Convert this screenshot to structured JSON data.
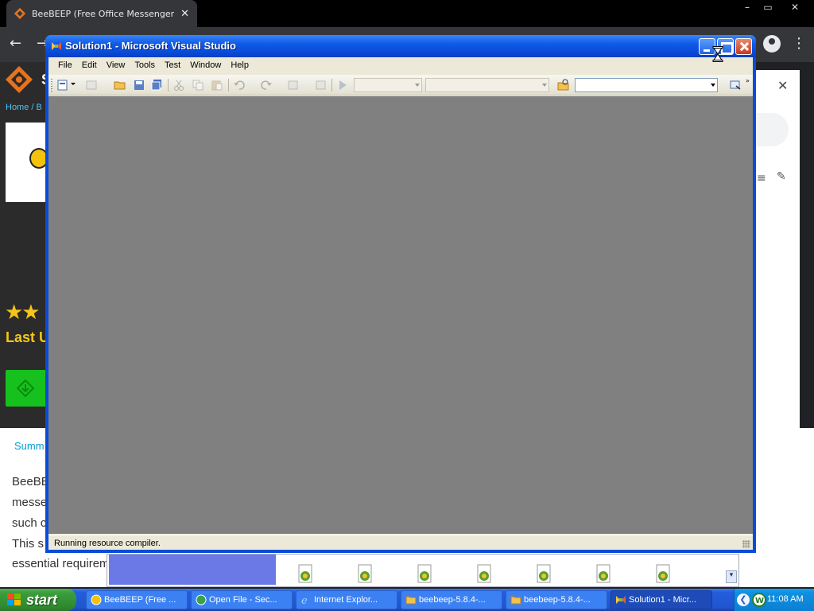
{
  "browser": {
    "tab_title": "BeeBEEP (Free Office Messenger) d",
    "tab_close": "✕",
    "window_controls": [
      "–",
      "▭",
      "✕"
    ],
    "nav_back": "←",
    "nav_forward": "→",
    "menu": "⋮"
  },
  "website": {
    "logo_initial": "S",
    "breadcrumb": "Home / B",
    "stars": "★★",
    "last_updated": "Last U",
    "summary_tab": "Summ",
    "summary_lines": [
      "BeeBE",
      "messe",
      "such c",
      "This s",
      "essential requirem"
    ],
    "side_close": "✕",
    "side_menu": "≡",
    "side_edit": "✎"
  },
  "vs": {
    "title": "Solution1 - Microsoft Visual Studio",
    "menu": [
      "File",
      "Edit",
      "View",
      "Tools",
      "Test",
      "Window",
      "Help"
    ],
    "status": "Running resource compiler.",
    "colors": {
      "title_blue": "#0f5ae7",
      "mdi_gray": "#808080",
      "chrome_face": "#ece9d8"
    }
  },
  "file_strip": {
    "scroll_down": "▾",
    "file_count": 7
  },
  "taskbar": {
    "start_label": "start",
    "items": [
      "BeeBEEP (Free ...",
      "Open File - Sec...",
      "Internet Explor...",
      "beebeep-5.8.4-...",
      "beebeep-5.8.4-...",
      "Solution1 - Micr..."
    ],
    "tray_chevron": "❮",
    "clock": "11:08 AM"
  }
}
